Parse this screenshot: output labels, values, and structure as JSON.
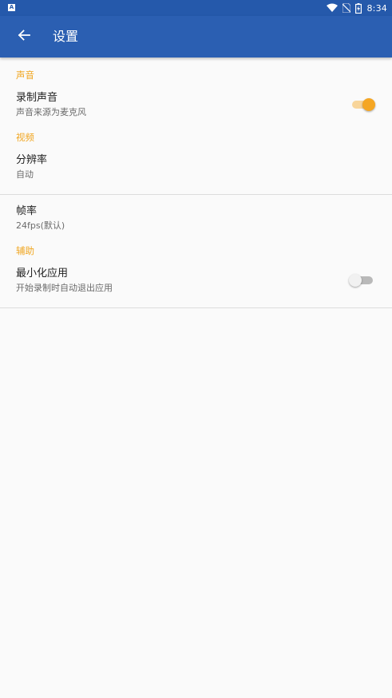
{
  "status_bar": {
    "time": "8:34",
    "notification_icon_letter": "A",
    "icons": [
      "wifi-icon",
      "no-sim-icon",
      "battery-charging-icon"
    ]
  },
  "app_bar": {
    "title": "设置",
    "background": "#2b5fb2"
  },
  "sections": [
    {
      "header": "声音",
      "items": [
        {
          "title": "录制声音",
          "summary": "声音来源为麦克风",
          "toggle": true
        }
      ]
    },
    {
      "header": "视频",
      "items": [
        {
          "title": "分辨率",
          "summary": "自动"
        },
        {
          "title": "帧率",
          "summary": "24fps(默认)"
        }
      ]
    },
    {
      "header": "辅助",
      "items": [
        {
          "title": "最小化应用",
          "summary": "开始录制时自动退出应用",
          "toggle": false
        }
      ]
    }
  ],
  "colors": {
    "accent": "#f5a623",
    "section_header": "#f0a51f",
    "status_bar": "#2559ab"
  }
}
